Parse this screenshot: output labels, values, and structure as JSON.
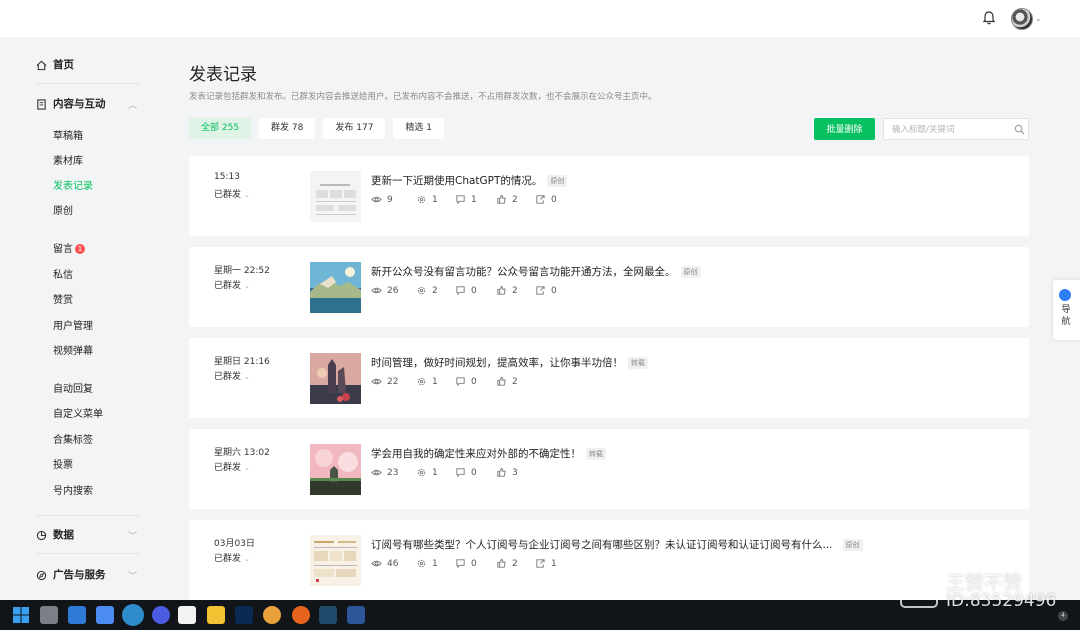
{
  "sidebar": {
    "home": "首页",
    "content_group": "内容与互动",
    "items": [
      {
        "label": "草稿箱",
        "active": false
      },
      {
        "label": "素材库",
        "active": false
      },
      {
        "label": "发表记录",
        "active": true
      },
      {
        "label": "原创",
        "active": false
      },
      {
        "label": "留言",
        "active": false,
        "badge": "1"
      },
      {
        "label": "私信",
        "active": false
      },
      {
        "label": "赞赏",
        "active": false
      },
      {
        "label": "用户管理",
        "active": false
      },
      {
        "label": "视频弹幕",
        "active": false
      },
      {
        "label": "自动回复",
        "active": false
      },
      {
        "label": "自定义菜单",
        "active": false
      },
      {
        "label": "合集标签",
        "active": false
      },
      {
        "label": "投票",
        "active": false
      },
      {
        "label": "号内搜索",
        "active": false
      }
    ],
    "data_group": "数据",
    "ads_group": "广告与服务"
  },
  "main": {
    "title": "发表记录",
    "description": "发表记录包括群发和发布。已群发内容会推送给用户。已发布内容不会推送，不占用群发次数，也不会展示在公众号主页中。",
    "tabs": [
      {
        "label": "全部 255",
        "active": true
      },
      {
        "label": "群发 78",
        "active": false
      },
      {
        "label": "发布 177",
        "active": false
      },
      {
        "label": "精选 1",
        "active": false
      }
    ],
    "batch_delete": "批量删除",
    "search_placeholder": "输入标题/关键词"
  },
  "posts": [
    {
      "time": "15:13",
      "status": "已群发",
      "title": "更新一下近期使用ChatGPT的情况。",
      "tag": "原创",
      "reads": "9",
      "shares": "1",
      "comments": "1",
      "likes": "2",
      "forwards": "0"
    },
    {
      "time": "星期一 22:52",
      "status": "已群发",
      "title": "新开公众号没有留言功能？公众号留言功能开通方法，全网最全。",
      "tag": "原创",
      "reads": "26",
      "shares": "2",
      "comments": "0",
      "likes": "2",
      "forwards": "0"
    },
    {
      "time": "星期日 21:16",
      "status": "已群发",
      "title": "时间管理，做好时间规划，提高效率，让你事半功倍！",
      "tag": "转载",
      "reads": "22",
      "shares": "1",
      "comments": "0",
      "likes": "2"
    },
    {
      "time": "星期六 13:02",
      "status": "已群发",
      "title": "学会用自我的确定性来应对外部的不确定性！",
      "tag": "转载",
      "reads": "23",
      "shares": "1",
      "comments": "0",
      "likes": "3"
    },
    {
      "time": "03月03日",
      "status": "已群发",
      "title": "订阅号有哪些类型？个人订阅号与企业订阅号之间有哪些区别？未认证订阅号和认证订阅号有什么...",
      "tag": "原创",
      "reads": "46",
      "shares": "1",
      "comments": "0",
      "likes": "2",
      "forwards": "1"
    }
  ],
  "nav_float": "导航",
  "watermark": {
    "name": "王赞不赞",
    "id": "ID:83529496"
  },
  "taskbar": {
    "notification_count": "4"
  },
  "colors": {
    "accent": "#07c160",
    "badge": "#fa5151",
    "background": "#f3f4f6"
  }
}
